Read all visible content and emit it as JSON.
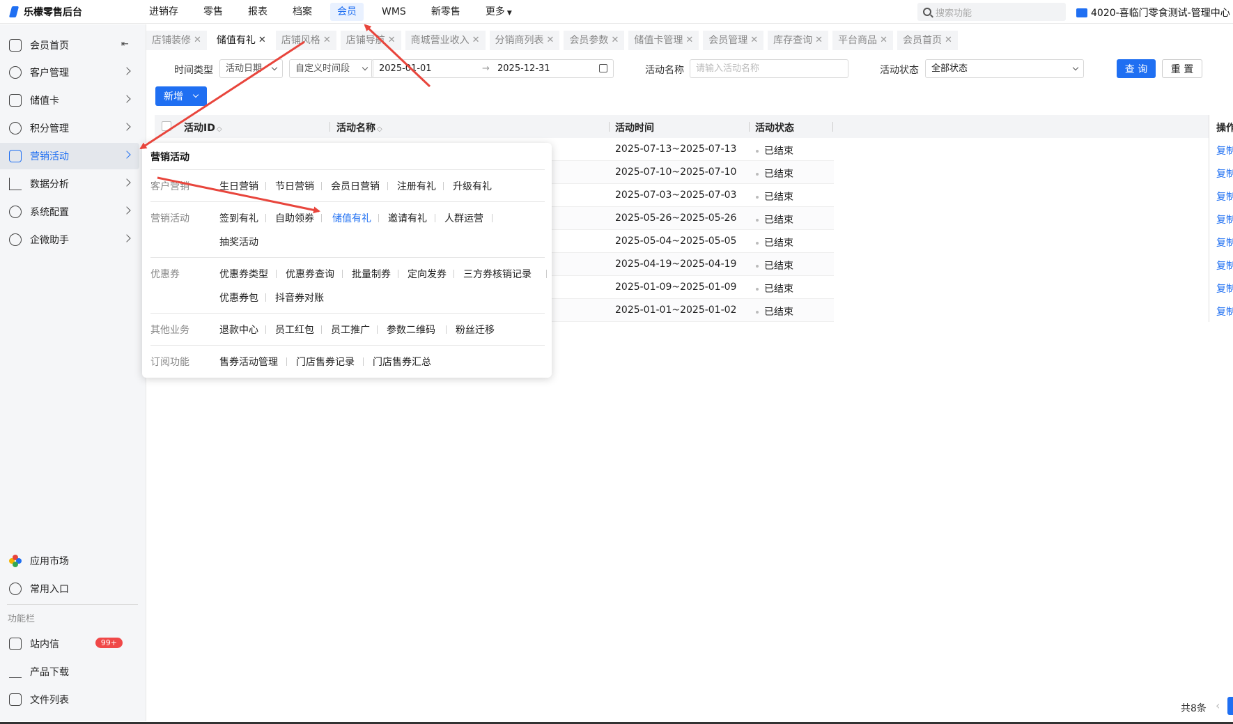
{
  "header": {
    "app_title": "乐檬零售后台",
    "nav": [
      "进销存",
      "零售",
      "报表",
      "档案",
      "会员",
      "WMS",
      "新零售",
      "更多"
    ],
    "active_nav": "会员",
    "search_placeholder": "搜索功能",
    "store": "4020-喜临门零食测试-管理中心"
  },
  "sidebar": {
    "items": [
      {
        "label": "会员首页",
        "icon": "home-icon"
      },
      {
        "label": "客户管理",
        "icon": "user-icon"
      },
      {
        "label": "储值卡",
        "icon": "card-icon"
      },
      {
        "label": "积分管理",
        "icon": "database-icon"
      },
      {
        "label": "营销活动",
        "icon": "chart-icon"
      },
      {
        "label": "数据分析",
        "icon": "trend-icon"
      },
      {
        "label": "系统配置",
        "icon": "settings-icon"
      },
      {
        "label": "企微助手",
        "icon": "chat-icon"
      }
    ],
    "bottom_items": [
      {
        "label": "应用市场",
        "icon": "app-market-icon"
      },
      {
        "label": "常用入口",
        "icon": "heart-icon"
      }
    ],
    "section_label": "功能栏",
    "tools": [
      {
        "label": "站内信",
        "icon": "mail-icon",
        "badge": "99+"
      },
      {
        "label": "产品下载",
        "icon": "download-icon"
      },
      {
        "label": "文件列表",
        "icon": "file-list-icon"
      }
    ]
  },
  "tabs": [
    "店铺装修",
    "储值有礼",
    "店铺风格",
    "店铺导航",
    "商城营业收入",
    "分销商列表",
    "会员参数",
    "储值卡管理",
    "会员管理",
    "库存查询",
    "平台商品",
    "会员首页"
  ],
  "active_tab": "储值有礼",
  "filters": {
    "time_type_label": "时间类型",
    "time_type_value": "活动日期",
    "period_value": "自定义时间段",
    "date_start": "2025-01-01",
    "date_arrow": "→",
    "date_end": "2025-12-31",
    "name_label": "活动名称",
    "name_placeholder": "请输入活动名称",
    "status_label": "活动状态",
    "status_value": "全部状态",
    "query_button": "查 询",
    "reset_button": "重 置",
    "add_button": "新增"
  },
  "table": {
    "columns": [
      "活动ID",
      "活动名称",
      "活动时间",
      "活动状态",
      "操作"
    ],
    "sort_glyph": "◇",
    "rows": [
      {
        "time": "2025-07-13~2025-07-13",
        "status": "已结束",
        "op": "复制"
      },
      {
        "time": "2025-07-10~2025-07-10",
        "status": "已结束",
        "op": "复制"
      },
      {
        "time": "2025-07-03~2025-07-03",
        "status": "已结束",
        "op": "复制"
      },
      {
        "time": "2025-05-26~2025-05-26",
        "status": "已结束",
        "op": "复制"
      },
      {
        "time": "2025-05-04~2025-05-05",
        "status": "已结束",
        "op": "复制"
      },
      {
        "time": "2025-04-19~2025-04-19",
        "status": "已结束",
        "op": "复制"
      },
      {
        "time": "2025-01-09~2025-01-09",
        "status": "已结束",
        "op": "复制"
      },
      {
        "time": "2025-01-01~2025-01-02",
        "status": "已结束",
        "op": "复制"
      }
    ],
    "total": "共8条"
  },
  "menu": {
    "title": "营销活动",
    "groups": [
      {
        "category": "客户营销",
        "lines": [
          [
            "生日营销",
            "节日营销",
            "会员日营销",
            "注册有礼",
            "升级有礼"
          ]
        ]
      },
      {
        "category": "营销活动",
        "lines": [
          [
            "签到有礼",
            "自助领券",
            "储值有礼",
            "邀请有礼",
            "人群运营"
          ],
          [
            "抽奖活动"
          ]
        ]
      },
      {
        "category": "优惠券",
        "lines": [
          [
            "优惠券类型",
            "优惠券查询",
            "批量制券",
            "定向发券",
            "三方券核销记录"
          ],
          [
            "优惠券包",
            "抖音券对账"
          ]
        ]
      },
      {
        "category": "其他业务",
        "lines": [
          [
            "退款中心",
            "员工红包",
            "员工推广",
            "参数二维码",
            "粉丝迁移"
          ]
        ]
      },
      {
        "category": "订阅功能",
        "lines": [
          [
            "售券活动管理",
            "门店售券记录",
            "门店售券汇总"
          ]
        ]
      }
    ],
    "highlighted": "储值有礼"
  },
  "colors": {
    "accent": "#1f6ff2",
    "annotation_arrow": "#e8453c",
    "badge": "#f04848"
  }
}
